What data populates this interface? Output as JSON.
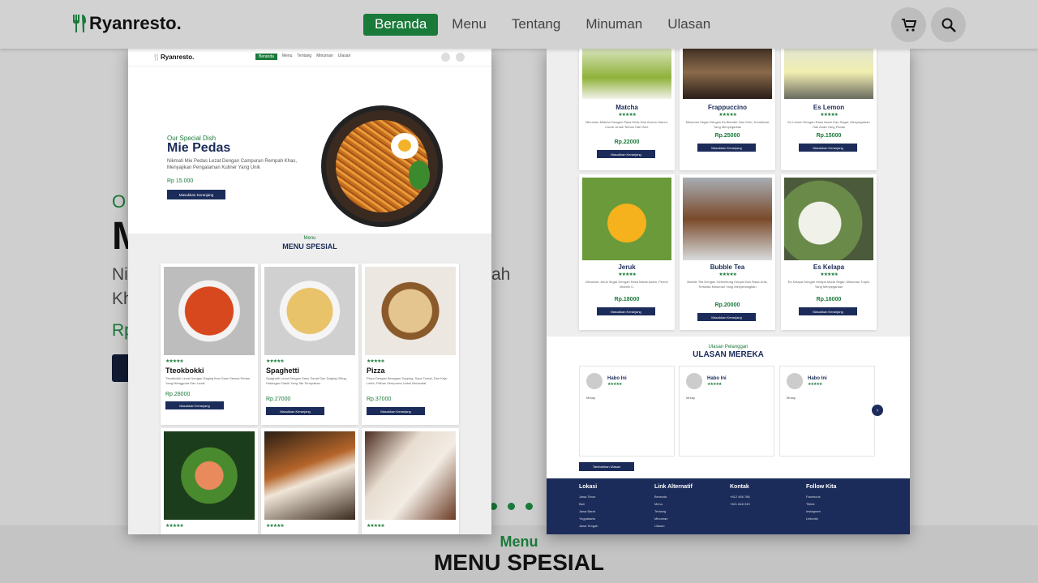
{
  "brand": {
    "name": "Ryanresto."
  },
  "nav": {
    "items": [
      {
        "label": "Beranda"
      },
      {
        "label": "Menu"
      },
      {
        "label": "Tentang"
      },
      {
        "label": "Minuman"
      },
      {
        "label": "Ulasan"
      }
    ],
    "cart_icon": "cart-icon",
    "search_icon": "search-icon"
  },
  "hero": {
    "subtitle_partial": "O",
    "title_partial": "M",
    "desc_line1": "Ni",
    "desc_line1_end": "ah",
    "desc_line2": "Kh",
    "price_partial": "Rp"
  },
  "section": {
    "subtitle": "Menu",
    "title": "MENU SPESIAL"
  },
  "left_preview": {
    "brand": "Ryanresto.",
    "nav": [
      "Beranda",
      "Menu",
      "Tentang",
      "Minuman",
      "Ulasan"
    ],
    "hero": {
      "subtitle": "Our Special Dish",
      "title": "Mie Pedas",
      "desc": "Nikmati Mie Pedas Lezat Dengan Campuran Rempah Khas, Menyajikan Pengalaman Kuliner Yang Unik",
      "price": "Rp 15.000",
      "button": "Masukkan Keranjang"
    },
    "section": {
      "subtitle": "Menu",
      "title": "MENU SPESIAL"
    },
    "cards": [
      {
        "name": "Tteokbokki",
        "stars": "★★★★✬",
        "desc": "Tteokbokki Lezat Dengan Daging Ikan Saus Sesuai Pedas Yang Menggoda Dan Lezat.",
        "price": "Rp.28000",
        "button": "Masukkan Keranjang"
      },
      {
        "name": "Spaghetti",
        "stars": "★★★★✬",
        "desc": "Spaghetti Lezat Dengan Saus Tomat Dan Daging Giling, Hidangan Klasik Yang Tak Terlupakan.",
        "price": "Rp.27000",
        "button": "Masukkan Keranjang"
      },
      {
        "name": "Pizza",
        "stars": "★★★★✬",
        "desc": "Pizza Dengan Beragam Topping, Saus Tomat, Dan Keju Leleh, Pilihan Sempurna Untuk Bersantai.",
        "price": "Rp.37000",
        "button": "Masukkan Keranjang"
      },
      {
        "name": "",
        "stars": "★★★★✬"
      },
      {
        "name": "",
        "stars": "★★★★✬"
      },
      {
        "name": "",
        "stars": "★★★★✬"
      }
    ]
  },
  "right_preview": {
    "drinks": [
      {
        "name": "Matcha",
        "stars": "★★★★✬",
        "desc": "Minuman Matcha Dengan Rasa Khas Dari Aroma Harum, Cocok Untuk Teman Hari Hari.",
        "price": "Rp.22000",
        "button": "Masukkan Keranjang"
      },
      {
        "name": "Frappuccino",
        "stars": "★★★★✬",
        "desc": "Minuman Segar Dengan Es Blender Dan Krim, Kombinasi Yang Menyegarkan",
        "price": "Rp.25000",
        "button": "Masukkan Keranjang"
      },
      {
        "name": "Es Lemon",
        "stars": "★★★★✬",
        "desc": "Es Lemon Dengan Rasa Asam Dan Segar, Menyegarkan Hari Anda Yang Panas",
        "price": "Rp.15000",
        "button": "Masukkan Keranjang"
      },
      {
        "name": "Jeruk",
        "stars": "★★★★✬",
        "desc": "Minuman Jeruk Segar Dengan Rasa Manis Asam, Penuh Vitamin C.",
        "price": "Rp.18000",
        "button": "Masukkan Keranjang"
      },
      {
        "name": "Bubble Tea",
        "stars": "★★★★✬",
        "desc": "Bubble Tea Dengan Gelembung Kenyal Dan Rasa Unik, Tersedia Minuman Yang Menyenangkan",
        "price": "Rp.20000",
        "button": "Masukkan Keranjang"
      },
      {
        "name": "Es Kelapa",
        "stars": "★★★★✬",
        "desc": "Es Kelapa Dengan Kelapa Muda Segar, Minuman Tropis Yang Menyegarkan",
        "price": "Rp.16000",
        "button": "Masukkan Keranjang"
      }
    ],
    "reviews": {
      "subtitle": "Ulasan Pelanggan",
      "title": "ULASAN MEREKA",
      "items": [
        {
          "name": "Habo Ini",
          "stars": "★★★★★",
          "text": "Mntap"
        },
        {
          "name": "Habo Ini",
          "stars": "★★★★★",
          "text": "Mntap"
        },
        {
          "name": "Habo Ini",
          "stars": "★★★★★",
          "text": "Mntap"
        }
      ],
      "button": "Tambahkan Ulasan"
    },
    "footer": [
      {
        "title": "Lokasi",
        "items": [
          "Jawa Timur",
          "Bali",
          "Jawa Barat",
          "Yogyakarta",
          "Jawa Tengah"
        ]
      },
      {
        "title": "Link Alternatif",
        "items": [
          "Beranda",
          "Menu",
          "Tentang",
          "Minuman",
          "Ulasan"
        ]
      },
      {
        "title": "Kontak",
        "items": [
          "+812 456 768",
          "+821 848 333"
        ]
      },
      {
        "title": "Follow Kita",
        "items": [
          "Facebook",
          "Tiktok",
          "Instagram",
          "Linkedin"
        ]
      }
    ]
  }
}
